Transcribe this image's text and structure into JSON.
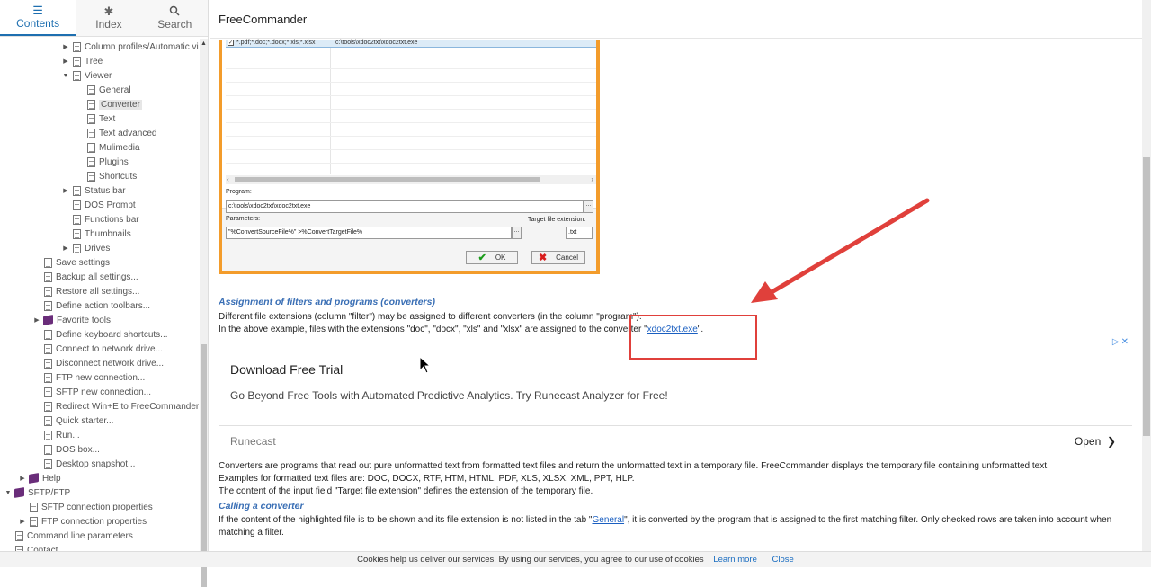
{
  "sidebar": {
    "tabs": [
      {
        "label": "Contents",
        "icon": "list-icon"
      },
      {
        "label": "Index",
        "icon": "asterisk-icon"
      },
      {
        "label": "Search",
        "icon": "search-icon"
      }
    ],
    "items": [
      {
        "label": "Column profiles/Automatic vie",
        "arrow": "▶",
        "kind": "doc"
      },
      {
        "label": "Tree",
        "arrow": "▶",
        "kind": "doc"
      },
      {
        "label": "Viewer",
        "arrow": "▼",
        "kind": "doc"
      },
      {
        "label": "General",
        "arrow": "",
        "kind": "doc"
      },
      {
        "label": "Converter",
        "arrow": "",
        "kind": "doc"
      },
      {
        "label": "Text",
        "arrow": "",
        "kind": "doc"
      },
      {
        "label": "Text advanced",
        "arrow": "",
        "kind": "doc"
      },
      {
        "label": "Mulimedia",
        "arrow": "",
        "kind": "doc"
      },
      {
        "label": "Plugins",
        "arrow": "",
        "kind": "doc"
      },
      {
        "label": "Shortcuts",
        "arrow": "",
        "kind": "doc"
      },
      {
        "label": "Status bar",
        "arrow": "▶",
        "kind": "doc"
      },
      {
        "label": "DOS Prompt",
        "arrow": "",
        "kind": "doc"
      },
      {
        "label": "Functions bar",
        "arrow": "",
        "kind": "doc"
      },
      {
        "label": "Thumbnails",
        "arrow": "",
        "kind": "doc"
      },
      {
        "label": "Drives",
        "arrow": "▶",
        "kind": "doc"
      },
      {
        "label": "Save settings",
        "arrow": "",
        "kind": "doc"
      },
      {
        "label": "Backup all settings...",
        "arrow": "",
        "kind": "doc"
      },
      {
        "label": "Restore all settings...",
        "arrow": "",
        "kind": "doc"
      },
      {
        "label": "Define action toolbars...",
        "arrow": "",
        "kind": "doc"
      },
      {
        "label": "Favorite tools",
        "arrow": "▶",
        "kind": "book"
      },
      {
        "label": "Define keyboard shortcuts...",
        "arrow": "",
        "kind": "doc"
      },
      {
        "label": "Connect to network drive...",
        "arrow": "",
        "kind": "doc"
      },
      {
        "label": "Disconnect network drive...",
        "arrow": "",
        "kind": "doc"
      },
      {
        "label": "FTP new connection...",
        "arrow": "",
        "kind": "doc"
      },
      {
        "label": "SFTP new connection...",
        "arrow": "",
        "kind": "doc"
      },
      {
        "label": "Redirect Win+E to FreeCommander",
        "arrow": "",
        "kind": "doc"
      },
      {
        "label": "Quick starter...",
        "arrow": "",
        "kind": "doc"
      },
      {
        "label": "Run...",
        "arrow": "",
        "kind": "doc"
      },
      {
        "label": "DOS box...",
        "arrow": "",
        "kind": "doc"
      },
      {
        "label": "Desktop snapshot...",
        "arrow": "",
        "kind": "doc"
      },
      {
        "label": "Help",
        "arrow": "▶",
        "kind": "book"
      },
      {
        "label": "SFTP/FTP",
        "arrow": "▼",
        "kind": "book"
      },
      {
        "label": "SFTP connection properties",
        "arrow": "",
        "kind": "doc"
      },
      {
        "label": "FTP connection properties",
        "arrow": "▶",
        "kind": "doc"
      },
      {
        "label": "Command line parameters",
        "arrow": "",
        "kind": "doc"
      },
      {
        "label": "Contact",
        "arrow": "",
        "kind": "doc"
      }
    ]
  },
  "main": {
    "title": "FreeCommander",
    "dialog": {
      "filter": "*.pdf;*.doc;*.docx;*.xls;*.xlsx",
      "program_path": "c:\\tools\\xdoc2txt\\xdoc2txt.exe",
      "program_label": "Program:",
      "program_value": "c:\\tools\\xdoc2txt\\xdoc2txt.exe",
      "parameters_label": "Parameters:",
      "parameters_value": "\"%ConvertSourceFile%\" >%ConvertTargetFile%",
      "target_label": "Target file extension:",
      "target_value": ".txt",
      "ok": "OK",
      "cancel": "Cancel",
      "dots": "..."
    },
    "section1_heading": "Assignment of filters and programs (converters)",
    "section1_p1": "Different file extensions (column \"filter\") may be assigned to different converters (in the column \"program\").",
    "section1_p2_pre": "In the above example, files with the extensions \"doc\", \"docx\", \"xls\" and \"xlsx\" are assigned to the converter \"",
    "section1_p2_link": "xdoc2txt.exe",
    "section1_p2_post": "\".",
    "ad": {
      "title": "Download Free Trial",
      "text": "Go Beyond Free Tools with Automated Predictive Analytics. Try Runecast Analyzer for Free!",
      "brand": "Runecast",
      "open": "Open",
      "adchoices": "▷✕"
    },
    "p2": "Converters are programs that read out pure unformatted text from formatted text files and return the unformatted text in a temporary file. FreeCommander displays the temporary file containing unformatted text.",
    "p3": "Examples for formatted text files are: DOC, DOCX, RTF, HTM, HTML, PDF, XLS, XLSX, XML, PPT, HLP.",
    "p4": "The content of the input field \"Target file extension\" defines the extension of the temporary file.",
    "section2_heading": "Calling a converter",
    "section2_p1_pre": "If the content of the highlighted file is to be shown and its file extension is not listed in the tab \"",
    "section2_p1_link": "General",
    "section2_p1_post": "\", it is converted by the program that is assigned to the first matching filter. Only checked rows are taken into account when",
    "section2_p1_line2": "matching a filter."
  },
  "cookie": {
    "text": "Cookies help us deliver our services. By using our services, you agree to our use of cookies",
    "learn": "Learn more",
    "close": "Close"
  },
  "colors": {
    "accent": "#1e6fb0",
    "callout": "#e0403b",
    "dialog_border": "#f39c2b"
  }
}
